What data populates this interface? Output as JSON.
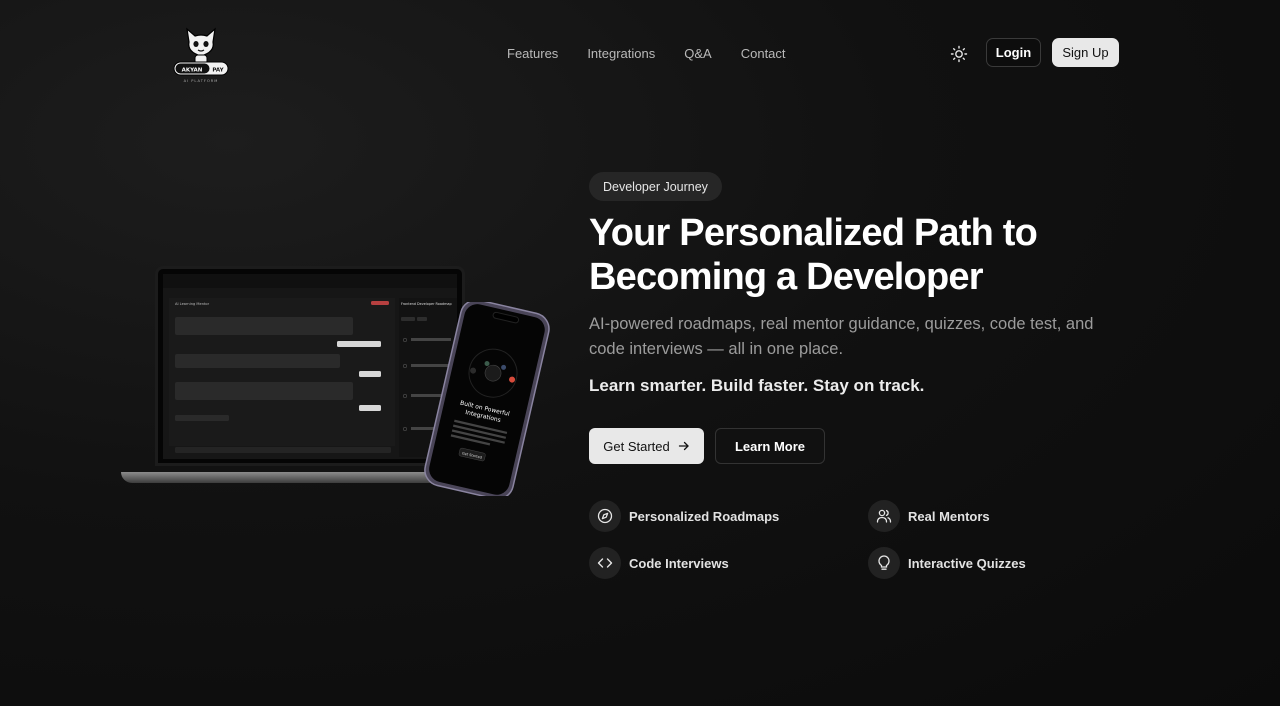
{
  "logo": {
    "text": "AKYAN PAY",
    "subtext": "AI PLATFORM"
  },
  "nav": {
    "items": [
      "Features",
      "Integrations",
      "Q&A",
      "Contact"
    ]
  },
  "auth": {
    "login": "Login",
    "signup": "Sign Up"
  },
  "hero": {
    "badge": "Developer Journey",
    "title": "Your Personalized Path to Becoming a Developer",
    "subtitle": "AI-powered roadmaps, real mentor guidance, quizzes, code test, and code interviews — all in one place.",
    "tagline": "Learn smarter. Build faster. Stay on track.",
    "cta_primary": "Get Started",
    "cta_secondary": "Learn More"
  },
  "features": [
    {
      "label": "Personalized Roadmaps",
      "icon": "compass-icon"
    },
    {
      "label": "Real Mentors",
      "icon": "users-icon"
    },
    {
      "label": "Code Interviews",
      "icon": "code-icon"
    },
    {
      "label": "Interactive Quizzes",
      "icon": "lightbulb-icon"
    }
  ],
  "mockup": {
    "laptop_title": "AI Learning Mentor",
    "laptop_panel_title": "Frontend Developer Roadmap",
    "phone_title": "Built on Powerful Integrations",
    "phone_button": "Get Started"
  },
  "colors": {
    "background": "#111111",
    "primary_button": "#e8e8e8",
    "accent_red": "#c0392b"
  }
}
